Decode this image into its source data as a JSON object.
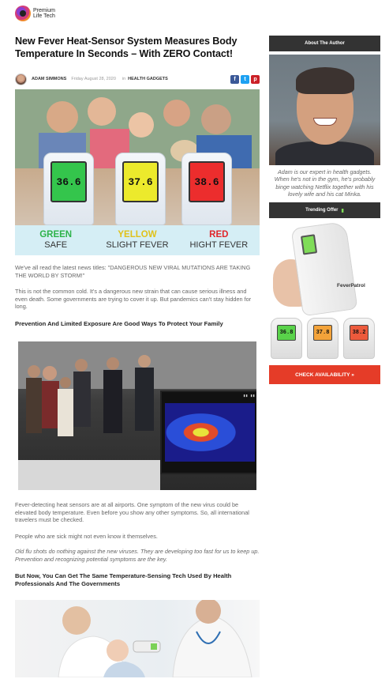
{
  "logo": {
    "line1": "Premium",
    "line2": "Life Tech"
  },
  "article": {
    "title": "New Fever Heat-Sensor System Measures Body Temperature In Seconds – With ZERO Contact!",
    "author": "ADAM SIMMONS",
    "date": "Friday August 28, 2020",
    "category_prefix": "in",
    "category": "HEALTH GADGETS",
    "share_icons": [
      "facebook-icon",
      "twitter-icon",
      "pinterest-icon"
    ],
    "hero": {
      "readings": [
        "36.6",
        "37.6",
        "38.6"
      ],
      "levels": [
        {
          "label": "GREEN",
          "sub": "SAFE",
          "color": "#2db34a"
        },
        {
          "label": "YELLOW",
          "sub": "SLIGHT FEVER",
          "color": "#e0c21a"
        },
        {
          "label": "RED",
          "sub": "HIGHT FEVER",
          "color": "#e0262b"
        }
      ]
    },
    "p1_lead": "We've all read the latest news titles: ",
    "p1_quote": "\"DANGEROUS NEW VIRAL MUTATIONS ARE TAKING THE WORLD BY STORM!\"",
    "p2": "This is not the common cold. It's a dangerous new strain that can cause serious illness and even death. Some governments are trying to cover it up. But pandemics can't stay hidden for long.",
    "h_prevention": "Prevention And Limited Exposure Are Good Ways To Protect Your Family",
    "p3": "Fever-detecting heat sensors are at all airports. One symptom of the new virus could be elevated body temperature. Even before you show any other symptoms. So, all international travelers must be checked.",
    "p4": "People who are sick might not even know it themselves.",
    "p5": "Old flu shots do nothing against the new viruses. They are developing too fast for us to keep up. Prevention and recognizing potential symptoms are the key.",
    "h_tech": "But Now, You Can Get The Same Temperature-Sensing Tech Used By Health Professionals And The Governments"
  },
  "sidebar": {
    "about_title": "About The Author",
    "bio": "Adam is our expert in health gadgets. When he's not in the gym, he's probably binge watching Netflix together with his lovely wife and his cat Minka.",
    "trending_title": "Trending Offer",
    "product_brand": "FeverPatrol",
    "product_readings": [
      "36.8",
      "37.8",
      "38.2"
    ],
    "cta_label": "CHECK AVAILABILITY »"
  }
}
